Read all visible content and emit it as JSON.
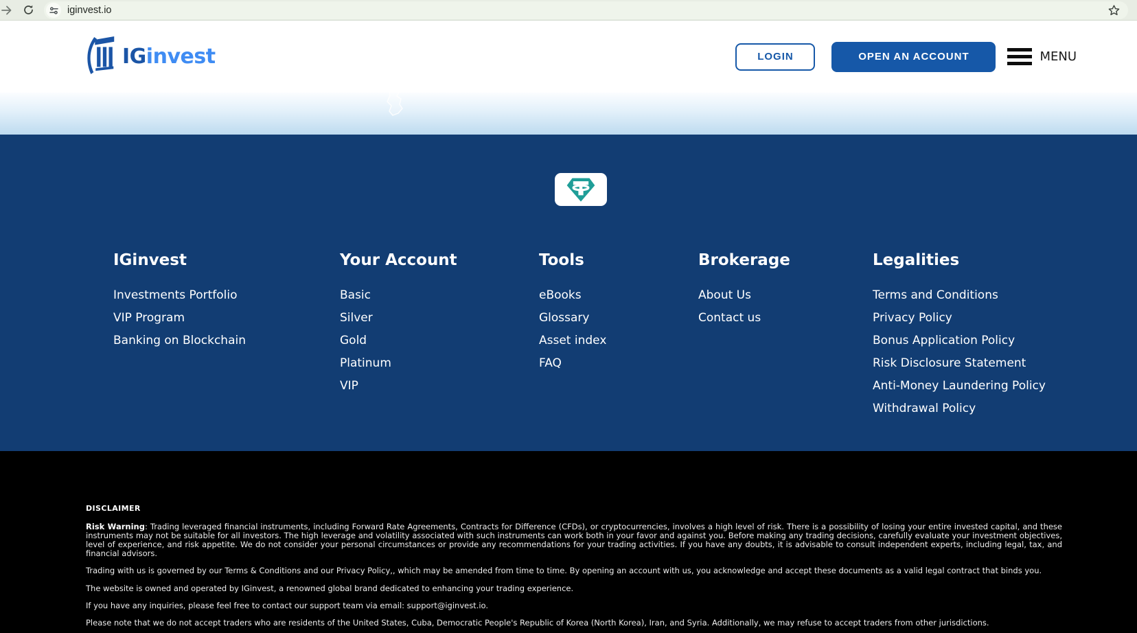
{
  "browser": {
    "url": "iginvest.io"
  },
  "header": {
    "brand": {
      "prefix": "IG",
      "suffix": "invest"
    },
    "login_label": "LOGIN",
    "open_account_label": "OPEN AN ACCOUNT",
    "menu_label": "MENU"
  },
  "icons": {
    "forward": "forward-arrow-icon",
    "reload": "reload-icon",
    "site_info": "site-settings-icon",
    "bookmark": "star-icon",
    "brand": "column-pillar-icon",
    "menu": "hamburger-icon",
    "footer_badge": "tether-icon"
  },
  "colors": {
    "brand_blue": "#1658a8",
    "brand_light_blue": "#3f8cf3",
    "footer_navy": "#123d73",
    "tether_teal": "#1f9e98",
    "disclaimer_bg": "#000000"
  },
  "footer": {
    "columns": [
      {
        "title": "IGinvest",
        "links": [
          "Investments Portfolio",
          "VIP Program",
          "Banking on Blockchain"
        ]
      },
      {
        "title": "Your Account",
        "links": [
          "Basic",
          "Silver",
          "Gold",
          "Platinum",
          "VIP"
        ]
      },
      {
        "title": "Tools",
        "links": [
          "eBooks",
          "Glossary",
          "Asset index",
          "FAQ"
        ]
      },
      {
        "title": "Brokerage",
        "links": [
          "About Us",
          "Contact us"
        ]
      },
      {
        "title": "Legalities",
        "links": [
          "Terms and Conditions",
          "Privacy Policy",
          "Bonus Application Policy",
          "Risk Disclosure Statement",
          "Anti-Money Laundering Policy",
          "Withdrawal Policy"
        ]
      }
    ]
  },
  "disclaimer": {
    "title": "DISCLAIMER",
    "risk_warning_label": "Risk Warning",
    "risk_warning_text": ": Trading leveraged financial instruments, including Forward Rate Agreements, Contracts for Difference (CFDs), or cryptocurrencies, involves a high level of risk. There is a possibility of losing your entire invested capital, and these instruments may not be suitable for all investors. The high leverage and volatility associated with such instruments can work both in your favor and against you. Before making any trading decisions, carefully evaluate your investment objectives, level of experience, and risk appetite. We do not consider your personal circumstances or provide any recommendations for your trading activities. If you have any doubts, it is advisable to consult independent experts, including legal, tax, and financial advisors.",
    "paragraphs": [
      "Trading with us is governed by our Terms & Conditions and our Privacy Policy,, which may be amended from time to time. By opening an account with us, you acknowledge and accept these documents as a valid legal contract that binds you.",
      "The website is owned and operated by IGinvest, a renowned global brand dedicated to enhancing your trading experience.",
      "If you have any inquiries, please feel free to contact our support team via email: support@iginvest.io.",
      "Please note that we do not accept traders who are residents of the United States, Cuba, Democratic People's Republic of Korea (North Korea), Iran, and Syria. Additionally, we may refuse to accept traders from other jurisdictions."
    ]
  }
}
